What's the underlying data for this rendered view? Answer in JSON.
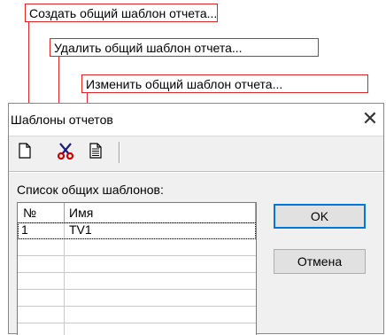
{
  "callouts": {
    "create": "Создать общий шаблон отчета...",
    "delete": "Удалить общий шаблон отчета...",
    "edit": "Изменить общий шаблон отчета..."
  },
  "dialog": {
    "title": "Шаблоны отчетов",
    "close_glyph": "✕",
    "toolbar": {
      "new_icon": "new-document-icon",
      "delete_icon": "scissors-icon",
      "edit_icon": "document-edit-icon"
    },
    "list_label": "Список общих шаблонов:",
    "table": {
      "headers": [
        "№",
        "Имя"
      ],
      "rows": [
        {
          "num": "1",
          "name": "TV1"
        }
      ]
    },
    "buttons": {
      "ok": "OK",
      "cancel": "Отмена"
    }
  },
  "colors": {
    "callout_border": "#e02424",
    "scissors": "#d00000",
    "default_button": "#0078d7"
  }
}
